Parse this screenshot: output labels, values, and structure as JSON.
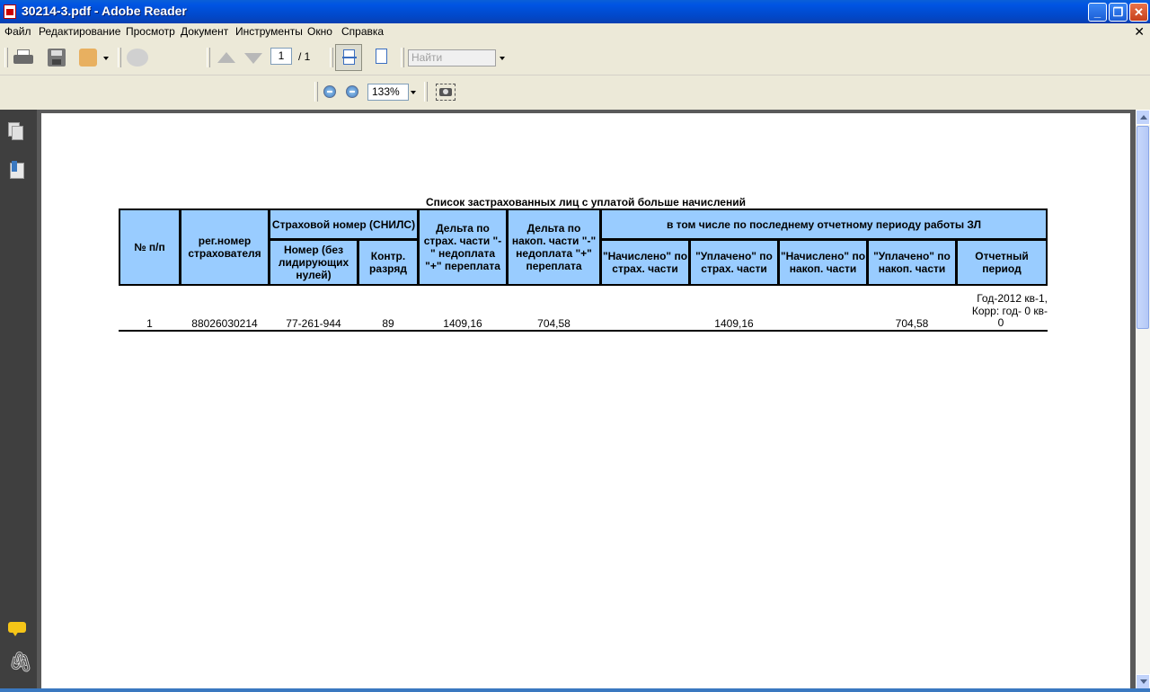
{
  "window": {
    "title": "30214-3.pdf - Adobe Reader"
  },
  "menu": [
    "Файл",
    "Редактирование",
    "Просмотр",
    "Документ",
    "Инструменты",
    "Окно",
    "Справка"
  ],
  "toolbar": {
    "current_page": "1",
    "page_total": "/ 1",
    "search_placeholder": "Найти",
    "zoom": "133%"
  },
  "document": {
    "title": "Список застрахованных лиц с уплатой больше начислений",
    "headers": {
      "num": "№ п/п",
      "reg": "рег.номер страхователя",
      "snils_group": "Страховой номер (СНИЛС)",
      "snils_number": "Номер (без лидирующих нулей)",
      "snils_control": "Контр. разряд",
      "delta_strah": "Дельта по страх. части \"-\" недоплата \"+\" переплата",
      "delta_nakop": "Дельта по накоп. части \"-\" недоплата \"+\" переплата",
      "period_group": "в том числе по последнему отчетному периоду работы ЗЛ",
      "accrued_strah": "\"Начислено\" по страх. части",
      "paid_strah": "\"Уплачено\" по страх. части",
      "accrued_nakop": "\"Начислено\" по накоп. части",
      "paid_nakop": "\"Уплачено\" по накоп. части",
      "report_period": "Отчетный период"
    },
    "rows": [
      {
        "num": "1",
        "reg": "88026030214",
        "snils_number": "77-261-944",
        "snils_control": "89",
        "delta_strah": "1409,16",
        "delta_nakop": "704,58",
        "accrued_strah": "",
        "paid_strah": "1409,16",
        "accrued_nakop": "",
        "paid_nakop": "704,58",
        "report_period_line1": "Год-2012 кв-1,",
        "report_period_line2": "Корр: год-   0 кв-",
        "report_period_line3": "0"
      }
    ]
  },
  "colors": {
    "header_fill": "#99ccff",
    "title_bar": "#0054e3",
    "nav_panel": "#3f3f3f"
  }
}
